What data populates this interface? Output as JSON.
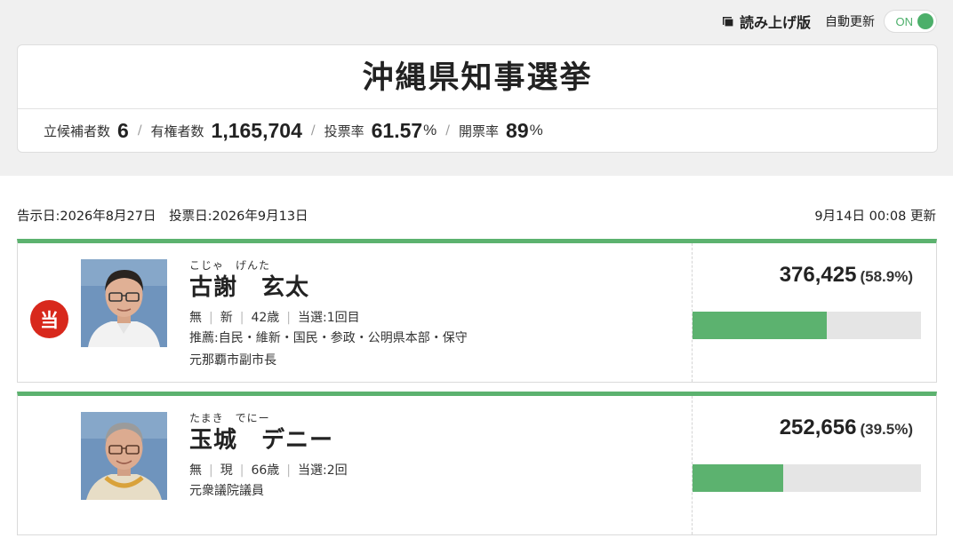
{
  "toolbar": {
    "read_aloud_label": "読み上げ版",
    "auto_update_label": "自動更新",
    "toggle_state": "ON"
  },
  "election": {
    "title": "沖縄県知事選挙",
    "stats": {
      "candidates_label": "立候補者数",
      "candidates_value": "6",
      "voters_label": "有権者数",
      "voters_value": "1,165,704",
      "turnout_label": "投票率",
      "turnout_value": "61.57",
      "turnout_unit": "%",
      "counted_label": "開票率",
      "counted_value": "89",
      "counted_unit": "%"
    },
    "announce_date": "告示日:2026年8月27日",
    "vote_date": "投票日:2026年9月13日",
    "updated": "9月14日 00:08 更新"
  },
  "candidates": [
    {
      "badge": "当",
      "kana": "こじゃ　げんた",
      "name": "古謝　玄太",
      "party": "無",
      "status": "新",
      "age": "42歳",
      "elected_count": "当選:1回目",
      "endorsement": "推薦:自民・維新・国民・参政・公明県本部・保守",
      "career": "元那覇市副市長",
      "votes": "376,425",
      "percent": "(58.9%)",
      "share": 0.589
    },
    {
      "badge": "",
      "kana": "たまき　でにー",
      "name": "玉城　デニー",
      "party": "無",
      "status": "現",
      "age": "66歳",
      "elected_count": "当選:2回",
      "career": "元衆議院議員",
      "votes": "252,656",
      "percent": "(39.5%)",
      "share": 0.395
    }
  ],
  "colors": {
    "accent_green": "#5cb26f",
    "win_badge_red": "#d8281c",
    "bar_track": "#e5e5e5"
  },
  "icons": {
    "read_aloud": "document-icon",
    "win": "elected-badge"
  }
}
